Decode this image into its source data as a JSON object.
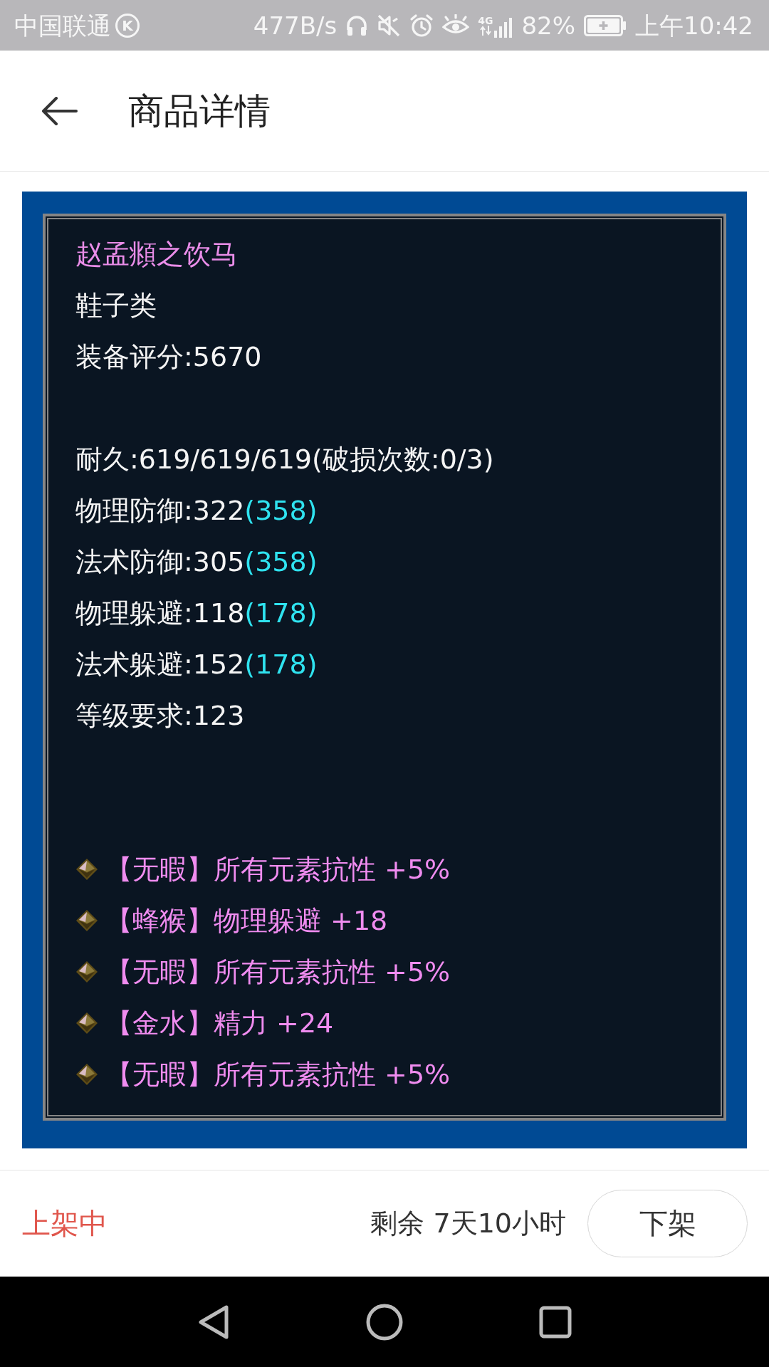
{
  "status_bar": {
    "carrier": "中国联通",
    "carrier_badge": "K",
    "net_speed": "477B/s",
    "network_type": "4G",
    "battery": "82%",
    "time": "上午10:42"
  },
  "header": {
    "title": "商品详情"
  },
  "item": {
    "name": "赵孟頫之饮马",
    "category": "鞋子类",
    "score": "装备评分:5670",
    "durability": "耐久:619/619/619(破损次数:0/3)",
    "stats": [
      {
        "base": "物理防御:322",
        "bonus": "(358)"
      },
      {
        "base": "法术防御:305",
        "bonus": "(358)"
      },
      {
        "base": "物理躲避:118",
        "bonus": "(178)"
      },
      {
        "base": "法术躲避:152",
        "bonus": "(178)"
      }
    ],
    "level_requirement": "等级要求:123",
    "gems": [
      "【无暇】所有元素抗性 +5%",
      "【蜂猴】物理躲避 +18",
      "【无暇】所有元素抗性 +5%",
      "【金水】精力 +24",
      "【无暇】所有元素抗性 +5%"
    ]
  },
  "footer": {
    "status": "上架中",
    "remaining": "剩余 7天10小时",
    "button": "下架"
  }
}
